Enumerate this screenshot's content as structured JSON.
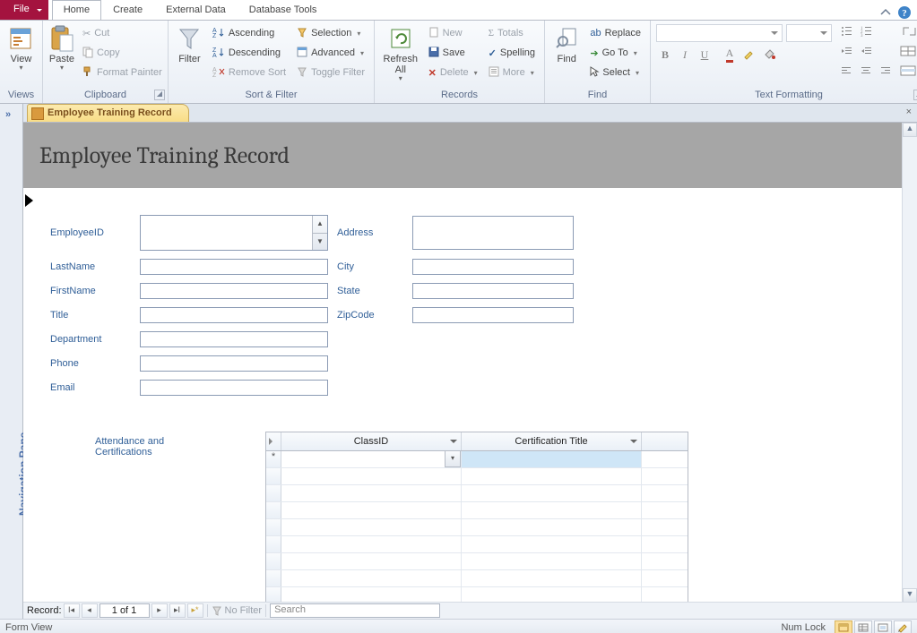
{
  "tabs": {
    "file": "File",
    "home": "Home",
    "create": "Create",
    "external": "External Data",
    "dbtools": "Database Tools"
  },
  "ribbon": {
    "views": {
      "view": "View",
      "group": "Views"
    },
    "clipboard": {
      "paste": "Paste",
      "cut": "Cut",
      "copy": "Copy",
      "fmtpaint": "Format Painter",
      "group": "Clipboard"
    },
    "sortfilter": {
      "filter": "Filter",
      "asc": "Ascending",
      "desc": "Descending",
      "remove": "Remove Sort",
      "selection": "Selection",
      "advanced": "Advanced",
      "toggle": "Toggle Filter",
      "group": "Sort & Filter"
    },
    "records": {
      "refresh": "Refresh\nAll",
      "new": "New",
      "save": "Save",
      "delete": "Delete",
      "totals": "Totals",
      "spelling": "Spelling",
      "more": "More",
      "group": "Records"
    },
    "find": {
      "find": "Find",
      "replace": "Replace",
      "goto": "Go To",
      "select": "Select",
      "group": "Find"
    },
    "textfmt": {
      "group": "Text Formatting"
    }
  },
  "navpane": {
    "label": "Navigation Pane",
    "expand": "»"
  },
  "doc": {
    "tab": "Employee Training Record",
    "title": "Employee Training Record",
    "close": "×",
    "labels": {
      "employeeid": "EmployeeID",
      "lastname": "LastName",
      "firstname": "FirstName",
      "title": "Title",
      "department": "Department",
      "phone": "Phone",
      "email": "Email",
      "address": "Address",
      "city": "City",
      "state": "State",
      "zip": "ZipCode",
      "attcert": "Attendance and Certifications"
    },
    "sub": {
      "classid": "ClassID",
      "cert": "Certification Title",
      "newmark": "*"
    },
    "recnav": {
      "label": "Record:",
      "pos": "1 of 1",
      "nofilter": "No Filter",
      "search": "Search"
    }
  },
  "status": {
    "view": "Form View",
    "numlock": "Num Lock"
  }
}
